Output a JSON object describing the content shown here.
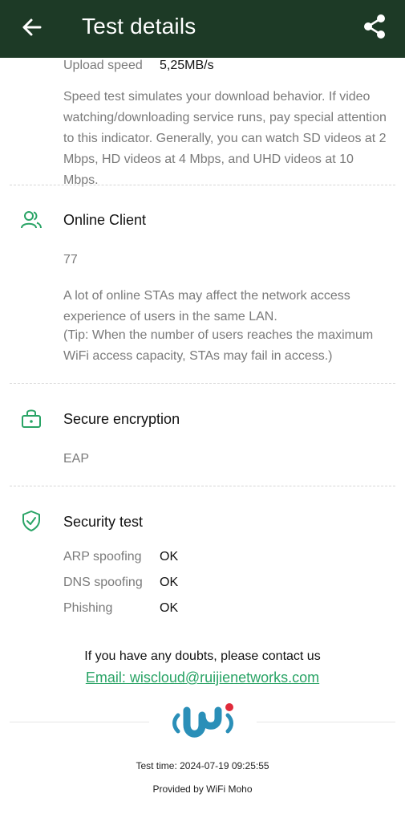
{
  "appbar": {
    "title": "Test details"
  },
  "speed": {
    "upload_label": "Upload speed",
    "upload_value": "5,25MB/s",
    "desc": "Speed test simulates your download behavior. If video watching/downloading service runs, pay special attention to this indicator. Generally, you can watch SD videos at 2 Mbps, HD videos at 4 Mbps, and UHD videos at 10 Mbps."
  },
  "online_client": {
    "title": "Online Client",
    "value": "77",
    "desc": "A lot of online STAs may affect the network access experience of users in the same LAN.",
    "tip": "(Tip: When the number of users reaches the maximum WiFi access capacity, STAs may fail in access.)"
  },
  "encryption": {
    "title": "Secure encryption",
    "value": "EAP"
  },
  "security": {
    "title": "Security test",
    "items": [
      {
        "label": "ARP spoofing",
        "value": "OK"
      },
      {
        "label": "DNS spoofing",
        "value": "OK"
      },
      {
        "label": "Phishing",
        "value": "OK"
      }
    ]
  },
  "contact": {
    "text": "If you have any doubts, please contact us",
    "email": "Email: wiscloud@ruijienetworks.com"
  },
  "footer": {
    "test_time": "Test time: 2024-07-19 09:25:55",
    "provided_by": "Provided by WiFi Moho"
  },
  "colors": {
    "appbar": "#1d3a26",
    "accent": "#2aa466",
    "logo_blue": "#2a8fb8",
    "logo_red": "#e02a3a"
  }
}
